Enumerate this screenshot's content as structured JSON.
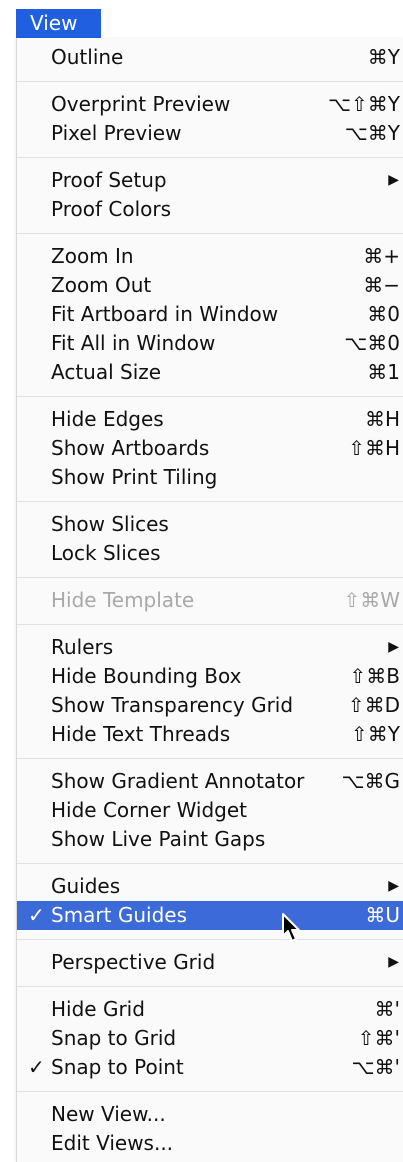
{
  "menu_title": "View",
  "items": {
    "outline": {
      "label": "Outline",
      "shortcut": "⌘Y"
    },
    "overprint_preview": {
      "label": "Overprint Preview",
      "shortcut": "⌥⇧⌘Y"
    },
    "pixel_preview": {
      "label": "Pixel Preview",
      "shortcut": "⌥⌘Y"
    },
    "proof_setup": {
      "label": "Proof Setup",
      "submenu_arrow": "▶"
    },
    "proof_colors": {
      "label": "Proof Colors"
    },
    "zoom_in": {
      "label": "Zoom In",
      "shortcut": "⌘+"
    },
    "zoom_out": {
      "label": "Zoom Out",
      "shortcut": "⌘−"
    },
    "fit_artboard": {
      "label": "Fit Artboard in Window",
      "shortcut": "⌘0"
    },
    "fit_all": {
      "label": "Fit All in Window",
      "shortcut": "⌥⌘0"
    },
    "actual_size": {
      "label": "Actual Size",
      "shortcut": "⌘1"
    },
    "hide_edges": {
      "label": "Hide Edges",
      "shortcut": "⌘H"
    },
    "show_artboards": {
      "label": "Show Artboards",
      "shortcut": "⇧⌘H"
    },
    "show_print_tiling": {
      "label": "Show Print Tiling"
    },
    "show_slices": {
      "label": "Show Slices"
    },
    "lock_slices": {
      "label": "Lock Slices"
    },
    "hide_template": {
      "label": "Hide Template",
      "shortcut": "⇧⌘W"
    },
    "rulers": {
      "label": "Rulers",
      "submenu_arrow": "▶"
    },
    "hide_bounding_box": {
      "label": "Hide Bounding Box",
      "shortcut": "⇧⌘B"
    },
    "show_transparency_grid": {
      "label": "Show Transparency Grid",
      "shortcut": "⇧⌘D"
    },
    "hide_text_threads": {
      "label": "Hide Text Threads",
      "shortcut": "⇧⌘Y"
    },
    "show_gradient_annotator": {
      "label": "Show Gradient Annotator",
      "shortcut": "⌥⌘G"
    },
    "hide_corner_widget": {
      "label": "Hide Corner Widget"
    },
    "show_live_paint_gaps": {
      "label": "Show Live Paint Gaps"
    },
    "guides": {
      "label": "Guides",
      "submenu_arrow": "▶"
    },
    "smart_guides": {
      "label": "Smart Guides",
      "shortcut": "⌘U",
      "check": "✓"
    },
    "perspective_grid": {
      "label": "Perspective Grid",
      "submenu_arrow": "▶"
    },
    "hide_grid": {
      "label": "Hide Grid",
      "shortcut": "⌘'"
    },
    "snap_to_grid": {
      "label": "Snap to Grid",
      "shortcut": "⇧⌘'"
    },
    "snap_to_point": {
      "label": "Snap to Point",
      "shortcut": "⌥⌘'",
      "check": "✓"
    },
    "new_view": {
      "label": "New View..."
    },
    "edit_views": {
      "label": "Edit Views..."
    }
  },
  "colors": {
    "highlight": "#3d6ad9",
    "title_bg": "#1f5fe0",
    "disabled_text": "#a9a9a9"
  }
}
